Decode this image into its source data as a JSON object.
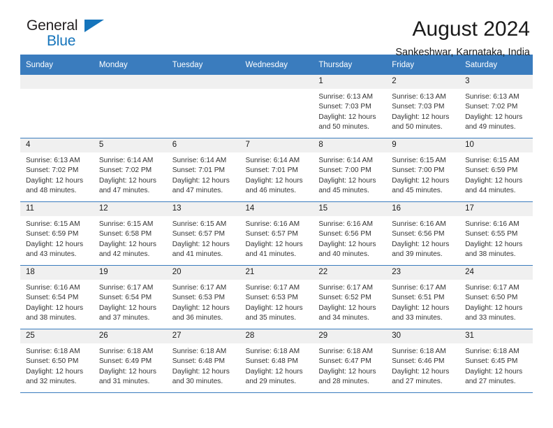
{
  "brand": {
    "name_part1": "General",
    "name_part2": "Blue",
    "logo_icon": "triangle-flag-icon"
  },
  "header": {
    "month_title": "August 2024",
    "location": "Sankeshwar, Karnataka, India"
  },
  "colors": {
    "header_blue": "#3a7cbe",
    "brand_blue": "#1574bb",
    "daynum_bg": "#f0f0f0",
    "text": "#1a1a1a"
  },
  "weekdays": [
    "Sunday",
    "Monday",
    "Tuesday",
    "Wednesday",
    "Thursday",
    "Friday",
    "Saturday"
  ],
  "weeks": [
    [
      {
        "day": "",
        "empty": true
      },
      {
        "day": "",
        "empty": true
      },
      {
        "day": "",
        "empty": true
      },
      {
        "day": "",
        "empty": true
      },
      {
        "day": "1",
        "sunrise": "Sunrise: 6:13 AM",
        "sunset": "Sunset: 7:03 PM",
        "daylight1": "Daylight: 12 hours",
        "daylight2": "and 50 minutes."
      },
      {
        "day": "2",
        "sunrise": "Sunrise: 6:13 AM",
        "sunset": "Sunset: 7:03 PM",
        "daylight1": "Daylight: 12 hours",
        "daylight2": "and 50 minutes."
      },
      {
        "day": "3",
        "sunrise": "Sunrise: 6:13 AM",
        "sunset": "Sunset: 7:02 PM",
        "daylight1": "Daylight: 12 hours",
        "daylight2": "and 49 minutes."
      }
    ],
    [
      {
        "day": "4",
        "sunrise": "Sunrise: 6:13 AM",
        "sunset": "Sunset: 7:02 PM",
        "daylight1": "Daylight: 12 hours",
        "daylight2": "and 48 minutes."
      },
      {
        "day": "5",
        "sunrise": "Sunrise: 6:14 AM",
        "sunset": "Sunset: 7:02 PM",
        "daylight1": "Daylight: 12 hours",
        "daylight2": "and 47 minutes."
      },
      {
        "day": "6",
        "sunrise": "Sunrise: 6:14 AM",
        "sunset": "Sunset: 7:01 PM",
        "daylight1": "Daylight: 12 hours",
        "daylight2": "and 47 minutes."
      },
      {
        "day": "7",
        "sunrise": "Sunrise: 6:14 AM",
        "sunset": "Sunset: 7:01 PM",
        "daylight1": "Daylight: 12 hours",
        "daylight2": "and 46 minutes."
      },
      {
        "day": "8",
        "sunrise": "Sunrise: 6:14 AM",
        "sunset": "Sunset: 7:00 PM",
        "daylight1": "Daylight: 12 hours",
        "daylight2": "and 45 minutes."
      },
      {
        "day": "9",
        "sunrise": "Sunrise: 6:15 AM",
        "sunset": "Sunset: 7:00 PM",
        "daylight1": "Daylight: 12 hours",
        "daylight2": "and 45 minutes."
      },
      {
        "day": "10",
        "sunrise": "Sunrise: 6:15 AM",
        "sunset": "Sunset: 6:59 PM",
        "daylight1": "Daylight: 12 hours",
        "daylight2": "and 44 minutes."
      }
    ],
    [
      {
        "day": "11",
        "sunrise": "Sunrise: 6:15 AM",
        "sunset": "Sunset: 6:59 PM",
        "daylight1": "Daylight: 12 hours",
        "daylight2": "and 43 minutes."
      },
      {
        "day": "12",
        "sunrise": "Sunrise: 6:15 AM",
        "sunset": "Sunset: 6:58 PM",
        "daylight1": "Daylight: 12 hours",
        "daylight2": "and 42 minutes."
      },
      {
        "day": "13",
        "sunrise": "Sunrise: 6:15 AM",
        "sunset": "Sunset: 6:57 PM",
        "daylight1": "Daylight: 12 hours",
        "daylight2": "and 41 minutes."
      },
      {
        "day": "14",
        "sunrise": "Sunrise: 6:16 AM",
        "sunset": "Sunset: 6:57 PM",
        "daylight1": "Daylight: 12 hours",
        "daylight2": "and 41 minutes."
      },
      {
        "day": "15",
        "sunrise": "Sunrise: 6:16 AM",
        "sunset": "Sunset: 6:56 PM",
        "daylight1": "Daylight: 12 hours",
        "daylight2": "and 40 minutes."
      },
      {
        "day": "16",
        "sunrise": "Sunrise: 6:16 AM",
        "sunset": "Sunset: 6:56 PM",
        "daylight1": "Daylight: 12 hours",
        "daylight2": "and 39 minutes."
      },
      {
        "day": "17",
        "sunrise": "Sunrise: 6:16 AM",
        "sunset": "Sunset: 6:55 PM",
        "daylight1": "Daylight: 12 hours",
        "daylight2": "and 38 minutes."
      }
    ],
    [
      {
        "day": "18",
        "sunrise": "Sunrise: 6:16 AM",
        "sunset": "Sunset: 6:54 PM",
        "daylight1": "Daylight: 12 hours",
        "daylight2": "and 38 minutes."
      },
      {
        "day": "19",
        "sunrise": "Sunrise: 6:17 AM",
        "sunset": "Sunset: 6:54 PM",
        "daylight1": "Daylight: 12 hours",
        "daylight2": "and 37 minutes."
      },
      {
        "day": "20",
        "sunrise": "Sunrise: 6:17 AM",
        "sunset": "Sunset: 6:53 PM",
        "daylight1": "Daylight: 12 hours",
        "daylight2": "and 36 minutes."
      },
      {
        "day": "21",
        "sunrise": "Sunrise: 6:17 AM",
        "sunset": "Sunset: 6:53 PM",
        "daylight1": "Daylight: 12 hours",
        "daylight2": "and 35 minutes."
      },
      {
        "day": "22",
        "sunrise": "Sunrise: 6:17 AM",
        "sunset": "Sunset: 6:52 PM",
        "daylight1": "Daylight: 12 hours",
        "daylight2": "and 34 minutes."
      },
      {
        "day": "23",
        "sunrise": "Sunrise: 6:17 AM",
        "sunset": "Sunset: 6:51 PM",
        "daylight1": "Daylight: 12 hours",
        "daylight2": "and 33 minutes."
      },
      {
        "day": "24",
        "sunrise": "Sunrise: 6:17 AM",
        "sunset": "Sunset: 6:50 PM",
        "daylight1": "Daylight: 12 hours",
        "daylight2": "and 33 minutes."
      }
    ],
    [
      {
        "day": "25",
        "sunrise": "Sunrise: 6:18 AM",
        "sunset": "Sunset: 6:50 PM",
        "daylight1": "Daylight: 12 hours",
        "daylight2": "and 32 minutes."
      },
      {
        "day": "26",
        "sunrise": "Sunrise: 6:18 AM",
        "sunset": "Sunset: 6:49 PM",
        "daylight1": "Daylight: 12 hours",
        "daylight2": "and 31 minutes."
      },
      {
        "day": "27",
        "sunrise": "Sunrise: 6:18 AM",
        "sunset": "Sunset: 6:48 PM",
        "daylight1": "Daylight: 12 hours",
        "daylight2": "and 30 minutes."
      },
      {
        "day": "28",
        "sunrise": "Sunrise: 6:18 AM",
        "sunset": "Sunset: 6:48 PM",
        "daylight1": "Daylight: 12 hours",
        "daylight2": "and 29 minutes."
      },
      {
        "day": "29",
        "sunrise": "Sunrise: 6:18 AM",
        "sunset": "Sunset: 6:47 PM",
        "daylight1": "Daylight: 12 hours",
        "daylight2": "and 28 minutes."
      },
      {
        "day": "30",
        "sunrise": "Sunrise: 6:18 AM",
        "sunset": "Sunset: 6:46 PM",
        "daylight1": "Daylight: 12 hours",
        "daylight2": "and 27 minutes."
      },
      {
        "day": "31",
        "sunrise": "Sunrise: 6:18 AM",
        "sunset": "Sunset: 6:45 PM",
        "daylight1": "Daylight: 12 hours",
        "daylight2": "and 27 minutes."
      }
    ]
  ]
}
